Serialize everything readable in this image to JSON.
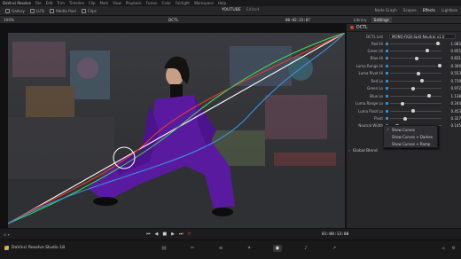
{
  "menubar": {
    "app": "DaVinci Resolve",
    "items": [
      "File",
      "Edit",
      "Trim",
      "Timeline",
      "Clip",
      "Mark",
      "View",
      "Playback",
      "Fusion",
      "Color",
      "Fairlight",
      "Workspace",
      "Help"
    ]
  },
  "toolbar": {
    "left": [
      "Gallery",
      "LUTs",
      "Media Pool",
      "Clips"
    ],
    "project": "YOUTUBE",
    "status": "Edited",
    "right": [
      "Node Graph",
      "Lightbox"
    ],
    "right2": [
      "Scopes",
      "Effects"
    ],
    "active_right": "Effects"
  },
  "subbar": {
    "zoom": "100%",
    "clip": "DCTL",
    "timecode": "00:02:33:07",
    "tabs": [
      "Library",
      "Settings"
    ],
    "active_tab": "Settings"
  },
  "panel": {
    "title": "DCTL",
    "dctl_list_label": "DCTL List",
    "dctl_list_value": "MONO-RGB-Split-Neutral v1.0",
    "params": [
      {
        "label": "Red Hi",
        "value": "1.085",
        "pos": 0.93
      },
      {
        "label": "Green Hi",
        "value": "0.955",
        "pos": 0.72
      },
      {
        "label": "Blue Hi",
        "value": "0.831",
        "pos": 0.52
      },
      {
        "label": "Luma Range Hi",
        "value": "0.300",
        "pos": 0.97
      },
      {
        "label": "Luma Pivot Hi",
        "value": "0.553",
        "pos": 0.55
      },
      {
        "label": "Red Lo",
        "value": "0.739",
        "pos": 0.62
      },
      {
        "label": "Green Lo",
        "value": "0.972",
        "pos": 0.45
      },
      {
        "label": "Blue Lo",
        "value": "1.138",
        "pos": 0.76
      },
      {
        "label": "Luma Range Lo",
        "value": "0.244",
        "pos": 0.24
      },
      {
        "label": "Luma Pivot Lo",
        "value": "0.453",
        "pos": 0.45
      },
      {
        "label": "Pivot",
        "value": "0.327",
        "pos": 0.3
      },
      {
        "label": "Neutral Width",
        "value": "0.145",
        "pos": 0.13
      }
    ],
    "menu": [
      "Show Curves",
      "Show Curves + Darken",
      "Show Curves + Ramp"
    ],
    "menu_checked": "Show Curves",
    "global_blend": "Global Blend"
  },
  "transport": {
    "timecode": "01:00:13:00"
  },
  "pagebar": {
    "brand": "DaVinci Resolve Studio 18",
    "pages": [
      "media-icon",
      "cut-icon",
      "edit-icon",
      "fusion-icon",
      "color-icon",
      "fairlight-icon",
      "deliver-icon"
    ],
    "active_page": "color-icon"
  },
  "colors": {
    "red_curve": "#e23b36",
    "green_curve": "#3fcf5a",
    "blue_curve": "#3c8ee6",
    "neutral_curve": "#ffffff",
    "suit": "#5a1aa0"
  }
}
